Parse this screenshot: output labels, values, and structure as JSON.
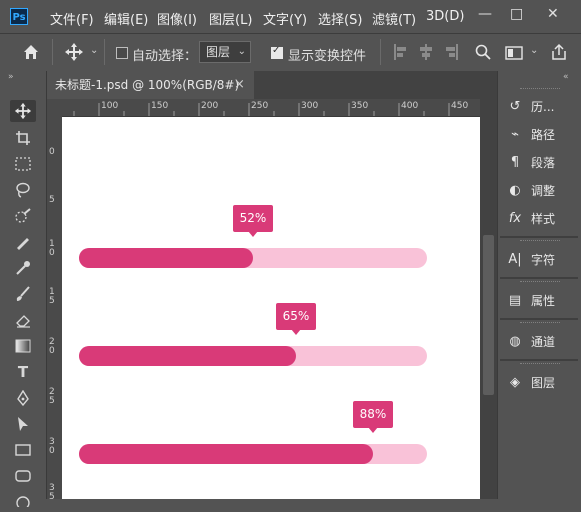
{
  "menu": [
    "文件(F)",
    "编辑(E)",
    "图像(I)",
    "图层(L)",
    "文字(Y)",
    "选择(S)",
    "滤镜(T)",
    "3D(D)"
  ],
  "app_logo": "Ps",
  "window_controls": [
    "—",
    "□",
    "✕"
  ],
  "options": {
    "auto_select_label": "自动选择：",
    "layer_select_value": "图层",
    "show_transform_label": "显示变换控件"
  },
  "document": {
    "tab_title": "未标题-1.psd @ 100%(RGB/8#)",
    "close": "×",
    "ruler_h": [
      "100",
      "150",
      "200",
      "250",
      "300",
      "350",
      "400",
      "450"
    ],
    "ruler_v": [
      "0",
      "5",
      "1 0",
      "1 5",
      "2 0",
      "2 5",
      "3 0",
      "3 5"
    ]
  },
  "progress_bars": [
    {
      "label": "52%",
      "percent": 52
    },
    {
      "label": "65%",
      "percent": 65
    },
    {
      "label": "88%",
      "percent": 88
    }
  ],
  "colors": {
    "fill": "#d93a78",
    "track": "#f9c2d8"
  },
  "panels": [
    {
      "icon": "history-icon",
      "glyph": "↺",
      "label": "历..."
    },
    {
      "icon": "paths-icon",
      "glyph": "⌁",
      "label": "路径"
    },
    {
      "icon": "paragraph-icon",
      "glyph": "¶",
      "label": "段落"
    },
    {
      "icon": "adjustments-icon",
      "glyph": "◐",
      "label": "调整"
    },
    {
      "icon": "styles-icon",
      "glyph": "fx",
      "label": "样式"
    },
    {
      "icon": "character-icon",
      "glyph": "A|",
      "label": "字符"
    },
    {
      "icon": "properties-icon",
      "glyph": "▤",
      "label": "属性"
    },
    {
      "icon": "channels-icon",
      "glyph": "◍",
      "label": "通道"
    },
    {
      "icon": "layers-icon",
      "glyph": "◈",
      "label": "图层"
    }
  ]
}
